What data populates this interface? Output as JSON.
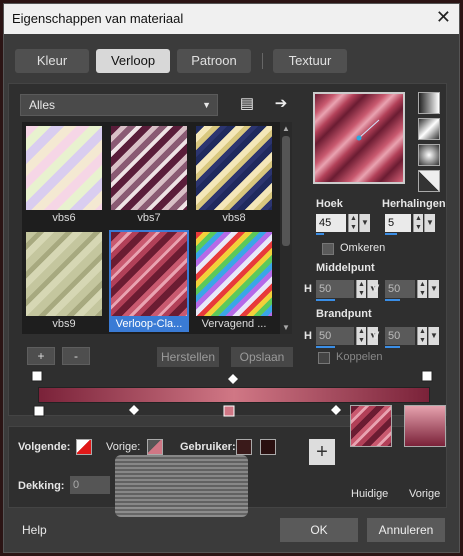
{
  "window": {
    "title": "Eigenschappen van materiaal"
  },
  "tabs": [
    {
      "label": "Kleur",
      "active": false
    },
    {
      "label": "Verloop",
      "active": true
    },
    {
      "label": "Patroon",
      "active": false
    },
    {
      "label": "Textuur",
      "active": false
    }
  ],
  "library": {
    "category": "Alles",
    "items": [
      {
        "label": "vbs6"
      },
      {
        "label": "vbs7"
      },
      {
        "label": "vbs8"
      },
      {
        "label": "vbs9"
      },
      {
        "label": "Verloop-Cla...",
        "selected": true
      },
      {
        "label": "Vervagend ..."
      }
    ],
    "add_label": "+",
    "remove_label": "-",
    "restore_label": "Herstellen",
    "save_label": "Opslaan"
  },
  "settings": {
    "angle_label": "Hoek",
    "angle_value": "45",
    "repeats_label": "Herhalingen",
    "repeats_value": "5",
    "invert_label": "Omkeren",
    "center_label": "Middelpunt",
    "center_h": "50",
    "center_v": "50",
    "focal_label": "Brandpunt",
    "focal_h": "50",
    "focal_v": "50",
    "link_label": "Koppelen",
    "h_label": "H",
    "v_label": "V"
  },
  "materials": {
    "next_label": "Volgende:",
    "prev_label": "Vorige:",
    "user_label": "Gebruiker:",
    "opacity_label": "Dekking:",
    "opacity_value": "0",
    "current_label": "Huidige",
    "previous_label": "Vorige"
  },
  "footer": {
    "help_label": "Help",
    "ok_label": "OK",
    "cancel_label": "Annuleren"
  },
  "colors": {
    "dark_rose": "#7a2239",
    "light_rose": "#d07785",
    "selection": "#3a7bd5"
  }
}
